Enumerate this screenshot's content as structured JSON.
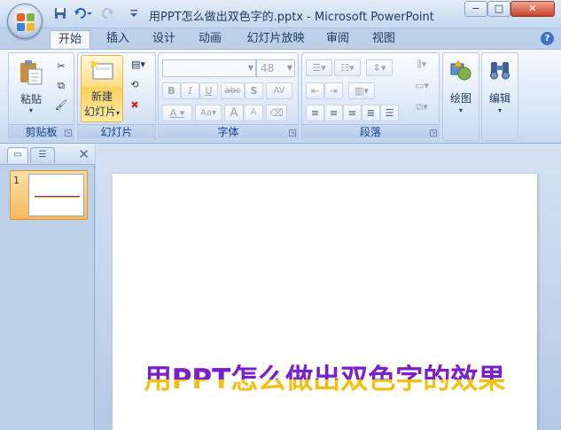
{
  "window": {
    "title": "用PPT怎么做出双色字的.pptx - Microsoft PowerPoint",
    "minimize": "−",
    "maximize": "□",
    "close": "✕"
  },
  "quick_access": {
    "save_icon": "save-icon",
    "undo_icon": "undo-icon",
    "redo_icon": "redo-icon",
    "customize_icon": "chevron-down-icon"
  },
  "tabs": [
    "开始",
    "插入",
    "设计",
    "动画",
    "幻灯片放映",
    "审阅",
    "视图"
  ],
  "active_tab": "开始",
  "ribbon": {
    "clipboard": {
      "label": "剪贴板",
      "paste": "粘贴"
    },
    "slides": {
      "label": "幻灯片",
      "new_slide_line1": "新建",
      "new_slide_line2": "幻灯片"
    },
    "font": {
      "label": "字体",
      "font_name": "",
      "font_size": "48",
      "bold": "B",
      "italic": "I",
      "underline": "U",
      "strike": "abc",
      "shadow": "S",
      "spacing": "AV",
      "color": "A",
      "case": "Aa",
      "grow": "A",
      "shrink": "A"
    },
    "paragraph": {
      "label": "段落"
    },
    "drawing": {
      "label": "绘图"
    },
    "editing": {
      "label": "编辑"
    }
  },
  "slide_panel": {
    "slide_number": "1",
    "close": "✕"
  },
  "slide": {
    "title": "用PPT怎么做出双色字的效果",
    "top_color": "#7a1fd0",
    "bottom_color": "#f2c014"
  }
}
